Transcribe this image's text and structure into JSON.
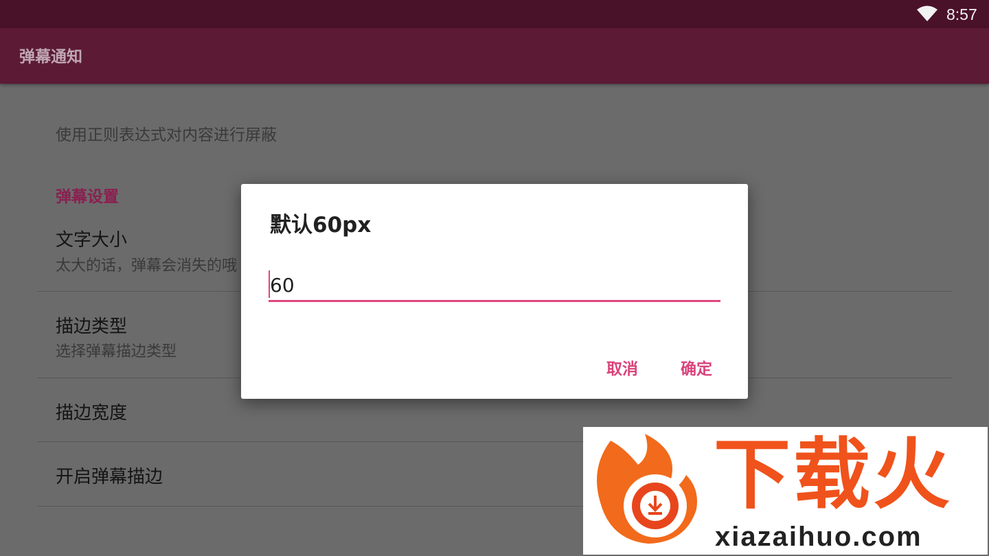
{
  "status_bar": {
    "time": "8:57",
    "wifi_icon": "wifi-icon"
  },
  "app_bar": {
    "title": "弹幕通知"
  },
  "preferences": {
    "summary_top": "使用正则表达式对内容进行屏蔽",
    "category": "弹幕设置",
    "items": [
      {
        "title": "文字大小",
        "summary": "太大的话，弹幕会消失的哦"
      },
      {
        "title": "描边类型",
        "summary": "选择弹幕描边类型"
      },
      {
        "title": "描边宽度",
        "summary": ""
      },
      {
        "title": "开启弹幕描边",
        "summary": ""
      }
    ]
  },
  "dialog": {
    "title": "默认60px",
    "input_value": "60",
    "cancel_label": "取消",
    "ok_label": "确定"
  },
  "watermark": {
    "brand": "下载火",
    "url": "xiazaihuo.com"
  },
  "colors": {
    "status_bar": "#4a1228",
    "app_bar": "#5c1a35",
    "accent": "#e0467e",
    "category": "#8a2050",
    "scrim_background": "#6b6b6b"
  }
}
